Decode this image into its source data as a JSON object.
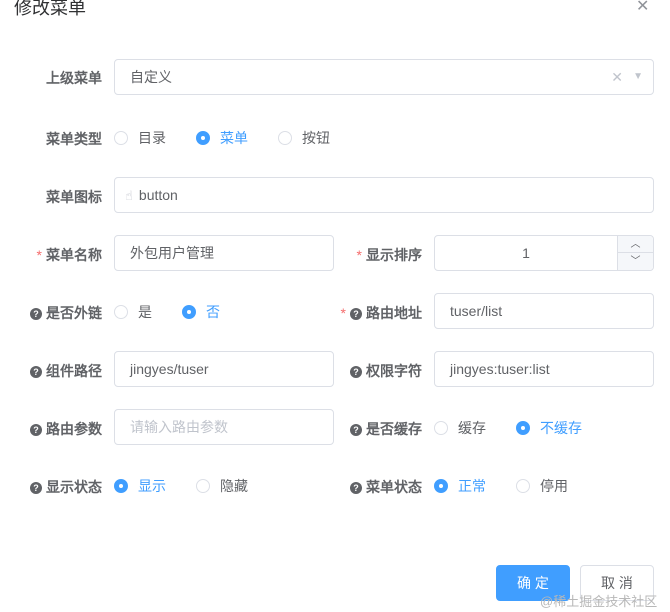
{
  "dialog": {
    "title": "修改菜单",
    "close_icon": "close-icon"
  },
  "form": {
    "parent_menu": {
      "label": "上级菜单",
      "value": "自定义"
    },
    "menu_type": {
      "label": "菜单类型",
      "options": [
        "目录",
        "菜单",
        "按钮"
      ],
      "selected": "菜单"
    },
    "menu_icon": {
      "label": "菜单图标",
      "value": "button",
      "icon": "hand-pointer-icon"
    },
    "menu_name": {
      "label": "菜单名称",
      "required": "*",
      "value": "外包用户管理"
    },
    "sort_order": {
      "label": "显示排序",
      "required": "*",
      "value": "1"
    },
    "external_link": {
      "label": "是否外链",
      "options": [
        "是",
        "否"
      ],
      "selected": "否"
    },
    "route_path": {
      "label": "路由地址",
      "required": "*",
      "value": "tuser/list"
    },
    "component_path": {
      "label": "组件路径",
      "value": "jingyes/tuser"
    },
    "permission": {
      "label": "权限字符",
      "value": "jingyes:tuser:list"
    },
    "route_params": {
      "label": "路由参数",
      "placeholder": "请输入路由参数"
    },
    "cache": {
      "label": "是否缓存",
      "options": [
        "缓存",
        "不缓存"
      ],
      "selected": "不缓存"
    },
    "visible": {
      "label": "显示状态",
      "options": [
        "显示",
        "隐藏"
      ],
      "selected": "显示"
    },
    "status": {
      "label": "菜单状态",
      "options": [
        "正常",
        "停用"
      ],
      "selected": "正常"
    }
  },
  "footer": {
    "confirm_label": "确 定",
    "cancel_label": "取 消"
  },
  "watermark": "@稀土掘金技术社区",
  "colors": {
    "primary": "#409eff",
    "required": "#f56c6c",
    "border": "#dcdfe6"
  }
}
